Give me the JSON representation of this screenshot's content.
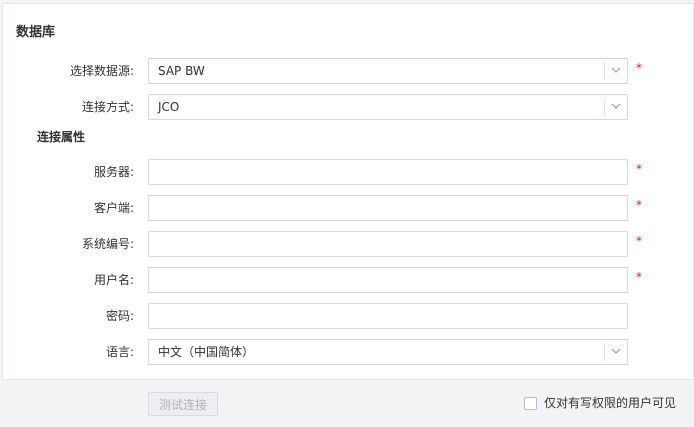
{
  "page": {
    "title": "数据库",
    "section_title": "连接属性"
  },
  "fields": {
    "datasource": {
      "label": "选择数据源:",
      "value": "SAP BW",
      "required": "*"
    },
    "connection_mode": {
      "label": "连接方式:",
      "value": "JCO"
    },
    "server": {
      "label": "服务器:",
      "value": "",
      "required": "*"
    },
    "client": {
      "label": "客户端:",
      "value": "",
      "required": "*"
    },
    "system_number": {
      "label": "系统编号:",
      "value": "",
      "required": "*"
    },
    "username": {
      "label": "用户名:",
      "value": "",
      "required": "*"
    },
    "password": {
      "label": "密码:",
      "value": ""
    },
    "language": {
      "label": "语言:",
      "value": "中文（中国简体）"
    }
  },
  "footer": {
    "test_button_label": "测试连接",
    "checkbox_label": "仅对有写权限的用户可见",
    "checkbox_checked": false
  },
  "icons": {
    "dropdown": "chevron-down-icon"
  },
  "colors": {
    "required": "#e02020",
    "border": "#d4d7dc",
    "disabled_text": "#b0b3b8"
  }
}
